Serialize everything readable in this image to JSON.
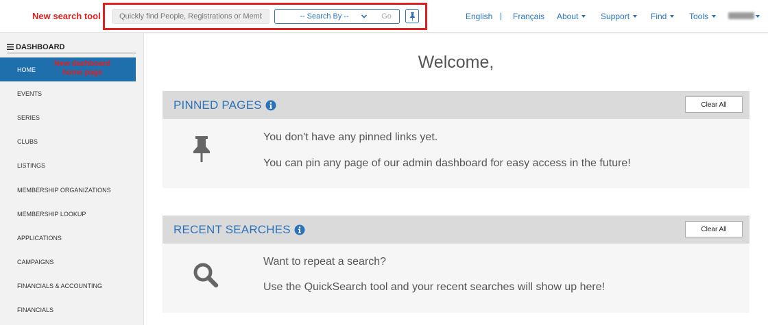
{
  "annotations": {
    "search_tool": "New search tool",
    "dashboard_home": "New dashboard home page"
  },
  "search": {
    "placeholder": "Quickly find People, Registrations or Member…",
    "search_by": "-- Search By --",
    "go_label": "Go"
  },
  "nav": {
    "lang_en": "English",
    "separator": "|",
    "lang_fr": "Français",
    "about": "About",
    "support": "Support",
    "find": "Find",
    "tools": "Tools"
  },
  "sidebar": {
    "title": "DASHBOARD",
    "items": [
      {
        "label": "HOME"
      },
      {
        "label": "EVENTS"
      },
      {
        "label": "SERIES"
      },
      {
        "label": "CLUBS"
      },
      {
        "label": "LISTINGS"
      },
      {
        "label": "MEMBERSHIP ORGANIZATIONS"
      },
      {
        "label": "MEMBERSHIP LOOKUP"
      },
      {
        "label": "APPLICATIONS"
      },
      {
        "label": "CAMPAIGNS"
      },
      {
        "label": "FINANCIALS & ACCOUNTING"
      },
      {
        "label": "FINANCIALS"
      }
    ]
  },
  "main": {
    "welcome": "Welcome,",
    "pinned": {
      "title": "PINNED PAGES",
      "clear_label": "Clear All",
      "line1": "You don't have any pinned links yet.",
      "line2": "You can pin any page of our admin dashboard for easy access in the future!"
    },
    "recent": {
      "title": "RECENT SEARCHES",
      "clear_label": "Clear All",
      "line1": "Want to repeat a search?",
      "line2": "Use the QuickSearch tool and your recent searches will show up here!"
    }
  },
  "colors": {
    "accent": "#2b73b8",
    "active_sidebar": "#1f6fad",
    "annotation": "#e02020"
  },
  "icons": [
    "pin-icon",
    "search-icon",
    "info-icon",
    "menu-icon",
    "chevron-down-icon"
  ]
}
